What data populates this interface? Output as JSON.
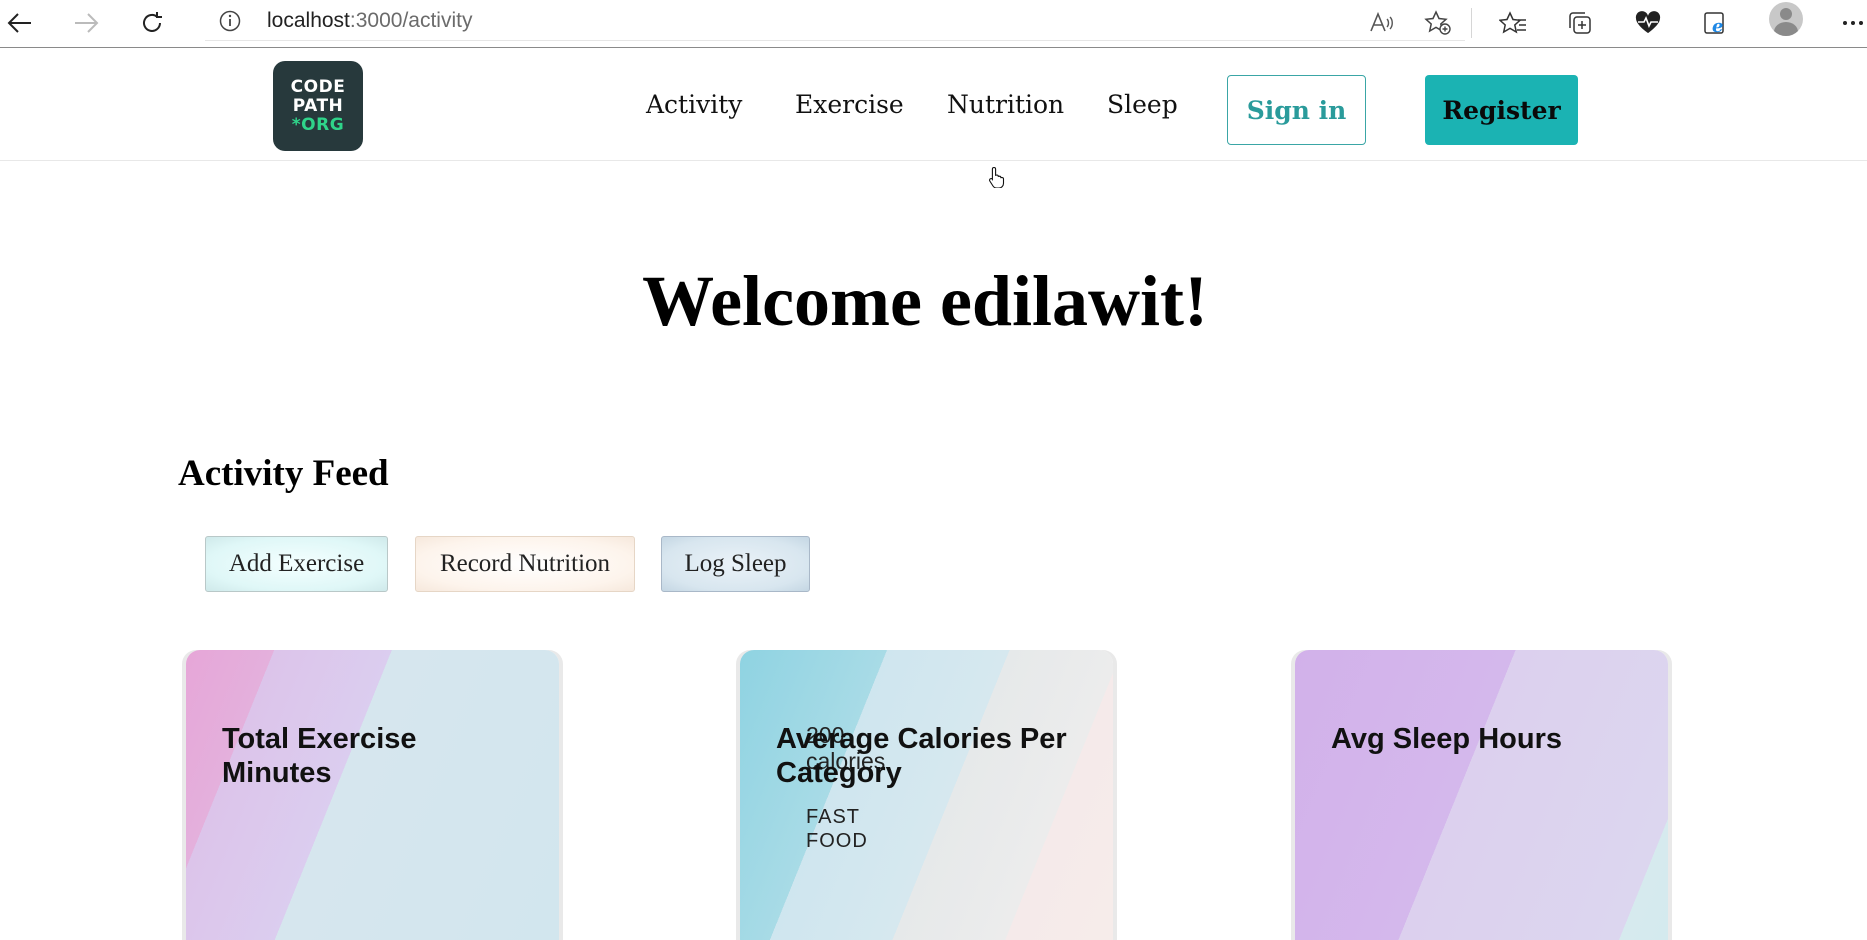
{
  "browser": {
    "url_host": "localhost",
    "url_path": ":3000/activity"
  },
  "navbar": {
    "logo": [
      "CODE",
      "PATH",
      "*ORG"
    ],
    "links": [
      "Activity",
      "Exercise",
      "Nutrition",
      "Sleep"
    ],
    "signin_label": "Sign in",
    "register_label": "Register"
  },
  "main": {
    "welcome": "Welcome edilawit!",
    "feed_title": "Activity Feed",
    "actions": [
      "Add Exercise",
      "Record Nutrition",
      "Log Sleep"
    ],
    "cards": [
      {
        "title": "Total Exercise Minutes"
      },
      {
        "title": "Average Calories Per Category",
        "value": "200 calories",
        "category": "FAST FOOD"
      },
      {
        "title": "Avg Sleep Hours"
      }
    ]
  },
  "colors": {
    "brand_teal": "#1bb3b3",
    "logo_bg": "#27393c",
    "logo_accent": "#2fd48a"
  }
}
